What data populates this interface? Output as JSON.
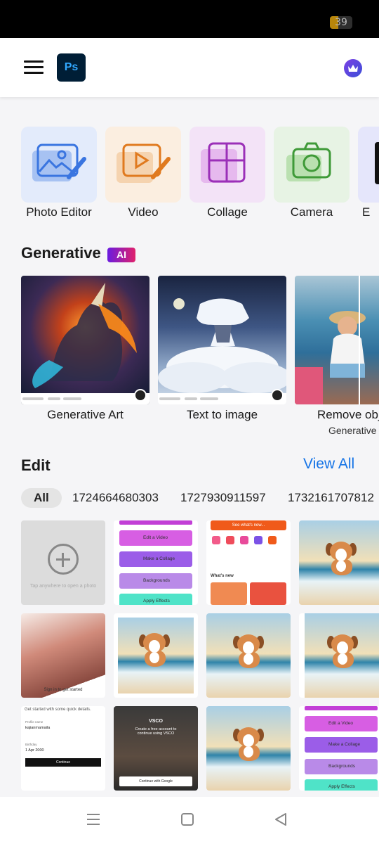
{
  "status_bar": {
    "battery_level": "39",
    "battery_fraction": 0.39
  },
  "app_bar": {
    "logo_text": "Ps",
    "menu_icon": "hamburger-menu-icon",
    "premium_icon": "crown-icon"
  },
  "tools": [
    {
      "label": "Photo Editor",
      "icon": "photo-edit-icon",
      "bg": "#e3ebfb"
    },
    {
      "label": "Video",
      "icon": "video-edit-icon",
      "bg": "#fbeee0"
    },
    {
      "label": "Collage",
      "icon": "collage-icon",
      "bg": "#f3e3f7"
    },
    {
      "label": "Camera",
      "icon": "camera-icon",
      "bg": "#e7f3e4"
    },
    {
      "label": "E",
      "icon": "edit-icon",
      "bg": "#e5e6fb"
    }
  ],
  "generative": {
    "title": "Generative",
    "badge": "AI",
    "cards": [
      {
        "label": "Generative Art",
        "sub": ""
      },
      {
        "label": "Text to image",
        "sub": ""
      },
      {
        "label": "Remove obj",
        "sub": "Generative"
      }
    ]
  },
  "edit": {
    "title": "Edit",
    "view_all": "View All",
    "filters": [
      "All",
      "1724664680303",
      "1727930911597",
      "1732161707812"
    ],
    "open_photo_hint": "Tap anywhere to open a photo",
    "menu_items": [
      "Edit a Video",
      "Make a Collage",
      "Backgrounds",
      "Apply Effects"
    ],
    "mini_screen_texts": {
      "signin": "Sign in to get started",
      "quick_details": "Get started with some quick details.",
      "profile_name_label": "Profile name",
      "profile_name_value": "kajianmamaila",
      "birthday_label": "Birthday",
      "birthday_value": "1 Apr 2000",
      "continue": "Continue",
      "vsco_brand": "VSCO",
      "vsco_tagline": "Create a free account to continue using VSCO",
      "continue_google": "Continue with Google",
      "whats_new": "What's new",
      "sees_whats_new": "See what's new..."
    }
  },
  "nav": {
    "recent_icon": "recent-apps-icon",
    "home_icon": "home-icon",
    "back_icon": "back-icon"
  }
}
